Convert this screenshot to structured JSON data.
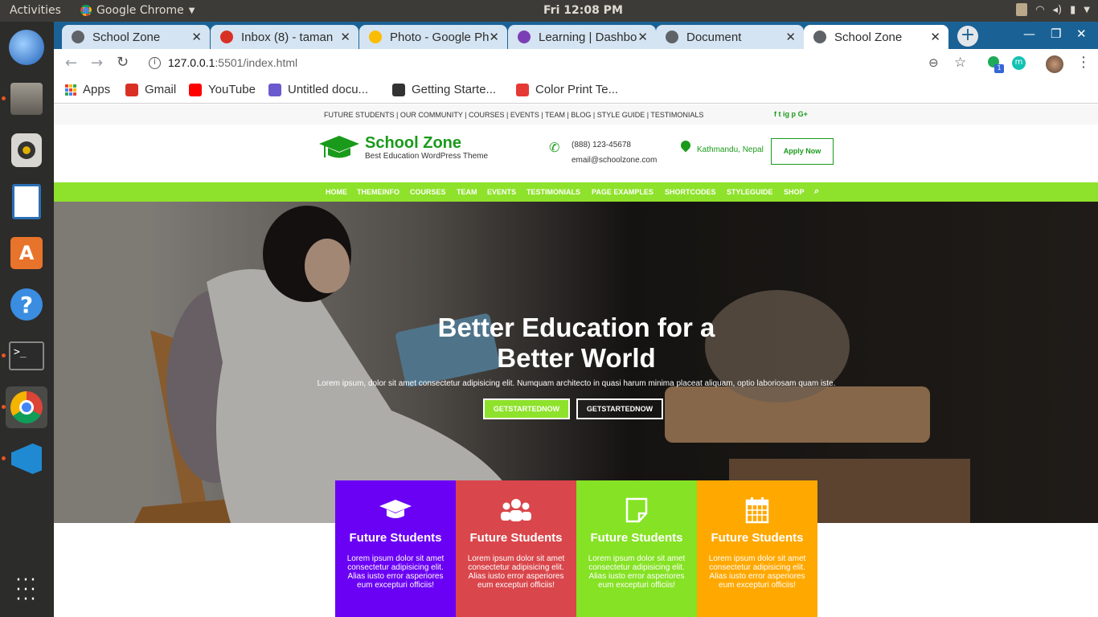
{
  "system": {
    "activities": "Activities",
    "app_name": "Google Chrome",
    "clock": "Fri 12:08 PM"
  },
  "tabs": [
    {
      "label": "School Zone",
      "color": "#5f6368"
    },
    {
      "label": "Inbox (8) - taman",
      "color": "#d93025"
    },
    {
      "label": "Photo - Google Ph",
      "color": "#fbbc04"
    },
    {
      "label": "Learning | Dashbo",
      "color": "#7b3fb5"
    },
    {
      "label": "Document",
      "color": "#5f6368"
    },
    {
      "label": "School Zone",
      "color": "#5f6368"
    }
  ],
  "address": {
    "host": "127.0.0.1",
    "path": ":5501/index.html"
  },
  "bookmarks": [
    {
      "label": "Apps",
      "color": "#4285f4"
    },
    {
      "label": "Gmail",
      "color": "#d93025"
    },
    {
      "label": "YouTube",
      "color": "#ff0000"
    },
    {
      "label": "Untitled docu...",
      "color": "#6a5acd"
    },
    {
      "label": "Getting Starte...",
      "color": "#333333"
    },
    {
      "label": "Color Print Te...",
      "color": "#e53935"
    }
  ],
  "site": {
    "toplinks": "FUTURE STUDENTS | OUR COMMUNITY | COURSES | EVENTS | TEAM | BLOG | STYLE GUIDE | TESTIMONIALS",
    "social": [
      "f",
      "t",
      "ig",
      "p",
      "G+"
    ],
    "brand": "School Zone",
    "tagline": "Best Education WordPress Theme",
    "phone": "(888) 123-45678",
    "email": "email@schoolzone.com",
    "location": "Kathmandu, Nepal",
    "apply": "Apply Now",
    "nav": [
      "HOME",
      "THEMEINFO",
      "COURSES",
      "TEAM",
      "EVENTS",
      "TESTIMONIALS",
      "PAGE EXAMPLES",
      "SHORTCODES",
      "STYLEGUIDE",
      "SHOP"
    ],
    "hero_line1": "Better Education for a",
    "hero_line2": "Better World",
    "hero_sub": "Lorem ipsum, dolor sit amet consectetur adipisicing elit. Numquam architecto in quasi harum minima placeat aliquam, optio laboriosam quam iste.",
    "btn1": "GETSTARTEDNOW",
    "btn2": "GETSTARTEDNOW",
    "accent": "#8ee22b",
    "brand_color": "#1a9a1a"
  },
  "cards": [
    {
      "title": "Future Students",
      "body": "Lorem ipsum dolor sit amet consectetur adipisicing elit. Alias iusto error asperiores eum excepturi officiis!",
      "color": "#6a00f4",
      "icon": "graduation-cap-icon"
    },
    {
      "title": "Future Students",
      "body": "Lorem ipsum dolor sit amet consectetur adipisicing elit. Alias iusto error asperiores eum excepturi officiis!",
      "color": "#d9464b",
      "icon": "users-icon"
    },
    {
      "title": "Future Students",
      "body": "Lorem ipsum dolor sit amet consectetur adipisicing elit. Alias iusto error asperiores eum excepturi officiis!",
      "color": "#85e224",
      "icon": "note-icon"
    },
    {
      "title": "Future Students",
      "body": "Lorem ipsum dolor sit amet consectetur adipisicing elit. Alias iusto error asperiores eum excepturi officiis!",
      "color": "#ffa800",
      "icon": "calendar-icon"
    }
  ]
}
